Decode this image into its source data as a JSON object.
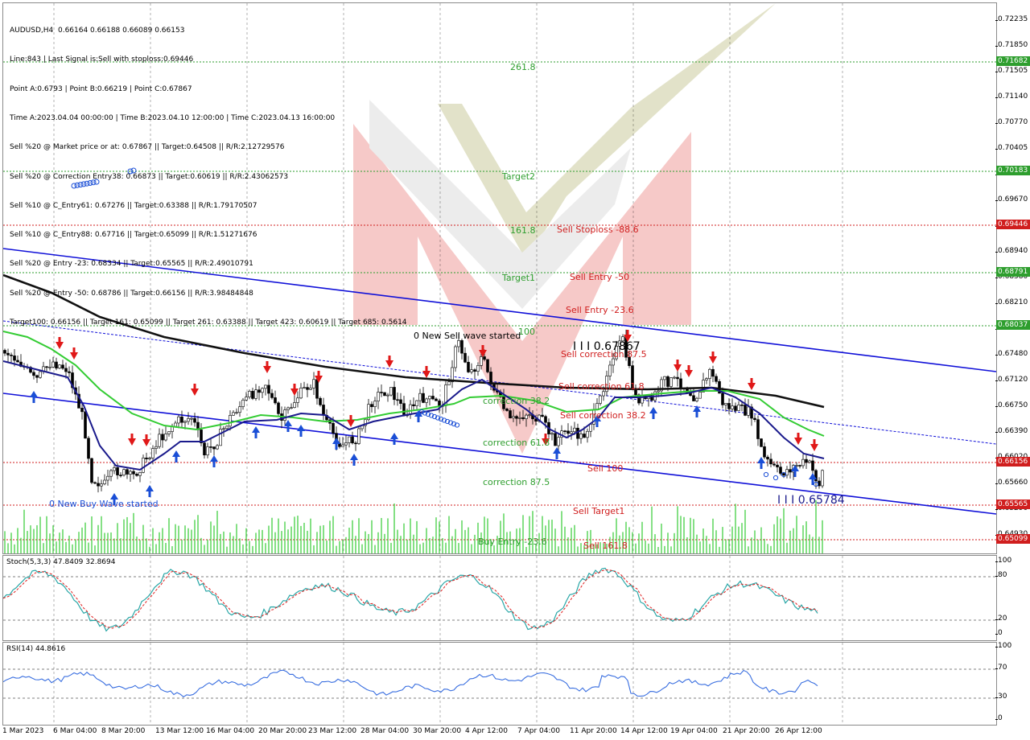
{
  "symbol_header": "AUDUSD,H4  0.66164 0.66188 0.66089 0.66153",
  "info_lines": [
    "Line:843 | Last Signal is:Sell with stoploss:0.69446",
    "Point A:0.6793 | Point B:0.66219 | Point C:0.67867",
    "Time A:2023.04.04 00:00:00 | Time B:2023.04.10 12:00:00 | Time C:2023.04.13 16:00:00",
    "Sell %20 @ Market price or at: 0.67867 || Target:0.64508 || R/R:2.12729576",
    "Sell %20 @ Correction Entry38: 0.66873 || Target:0.60619 || R/R:2.43062573",
    "Sell %10 @ C_Entry61: 0.67276 || Target:0.63388 || R/R:1.79170507",
    "Sell %10 @ C_Entry88: 0.67716 || Target:0.65099 || R/R:1.51271676",
    "Sell %20 @ Entry -23: 0.68334 || Target:0.65565 || R/R:2.49010791",
    "Sell %20 @ Entry -50: 0.68786 || Target:0.66156 || R/R:3.98484848",
    "Target100: 0.66156 || Target 161: 0.65099 || Target 261: 0.63388 || Target 423: 0.60619 || Target 685: 0.5614"
  ],
  "price_axis": [
    "0.72235",
    "0.71850",
    "0.71505",
    "0.71140",
    "0.70770",
    "0.70405",
    "0.70040",
    "0.69670",
    "0.69310",
    "0.68940",
    "0.68580",
    "0.68210",
    "0.67850",
    "0.67480",
    "0.67120",
    "0.66750",
    "0.66390",
    "0.66020",
    "0.65660",
    "0.65290",
    "0.64930"
  ],
  "price_labels": [
    {
      "text": "0.71682",
      "color": "#2e9e2e"
    },
    {
      "text": "0.70183",
      "color": "#2e9e2e"
    },
    {
      "text": "0.69446",
      "color": "#d01e1e"
    },
    {
      "text": "0.68791",
      "color": "#2e9e2e"
    },
    {
      "text": "0.68037",
      "color": "#2e9e2e"
    },
    {
      "text": "0.66156",
      "color": "#d01e1e"
    },
    {
      "text": "0.65565",
      "color": "#d01e1e"
    },
    {
      "text": "0.65099",
      "color": "#d01e1e"
    }
  ],
  "level_labels": [
    {
      "text": "261.8",
      "color": "#2e9e2e"
    },
    {
      "text": "Target2",
      "color": "#2e9e2e"
    },
    {
      "text": "161.8",
      "color": "#2e9e2e"
    },
    {
      "text": "Sell Stoploss -88.6",
      "color": "#d01e1e"
    },
    {
      "text": "Target1",
      "color": "#2e9e2e"
    },
    {
      "text": "Sell Entry -50",
      "color": "#d01e1e"
    },
    {
      "text": "Sell Entry -23.6",
      "color": "#d01e1e"
    },
    {
      "text": "100",
      "color": "#2e9e2e"
    },
    {
      "text": "Sell correction 87.5",
      "color": "#d01e1e"
    },
    {
      "text": "Sell correction 61.8",
      "color": "#d01e1e"
    },
    {
      "text": "Sell correction 38.2",
      "color": "#d01e1e"
    },
    {
      "text": "correction 38.2",
      "color": "#2e9e2e"
    },
    {
      "text": "correction 61.8",
      "color": "#2e9e2e"
    },
    {
      "text": "correction 87.5",
      "color": "#2e9e2e"
    },
    {
      "text": "Sell 100",
      "color": "#d01e1e"
    },
    {
      "text": "Sell Target1",
      "color": "#d01e1e"
    },
    {
      "text": "Buy Entry -23.6",
      "color": "#2e9e2e"
    },
    {
      "text": "Sell 161.8",
      "color": "#d01e1e"
    }
  ],
  "wave_labels": {
    "sell_wave": "0 New Sell wave started",
    "buy_wave": "0 New Buy Wave started",
    "point_c": "I I I 0.67867",
    "point_low": "I I I 0.65784"
  },
  "stoch": {
    "title": "Stoch(5,3,3) 47.8409 32.8694",
    "axis": [
      "100",
      "80",
      "20",
      "0"
    ]
  },
  "rsi": {
    "title": "RSI(14) 44.8616",
    "axis": [
      "100",
      "70",
      "30",
      "0"
    ]
  },
  "time_axis": [
    "1 Mar 2023",
    "6 Mar 04:00",
    "8 Mar 20:00",
    "13 Mar 12:00",
    "16 Mar 04:00",
    "20 Mar 20:00",
    "23 Mar 12:00",
    "28 Mar 04:00",
    "30 Mar 20:00",
    "4 Apr 12:00",
    "7 Apr 04:00",
    "11 Apr 20:00",
    "14 Apr 12:00",
    "19 Apr 04:00",
    "21 Apr 20:00",
    "26 Apr 12:00"
  ],
  "colors": {
    "channel": "#1010d8",
    "ma_black": "#111111",
    "ma_green": "#33cc33",
    "ma_navy": "#1a1a8c",
    "bull_arrow": "#1a4ed6",
    "bear_arrow": "#e01818",
    "stoch_main": "#2aa7a7",
    "stoch_signal": "#e02020",
    "rsi": "#3a6fe0"
  }
}
